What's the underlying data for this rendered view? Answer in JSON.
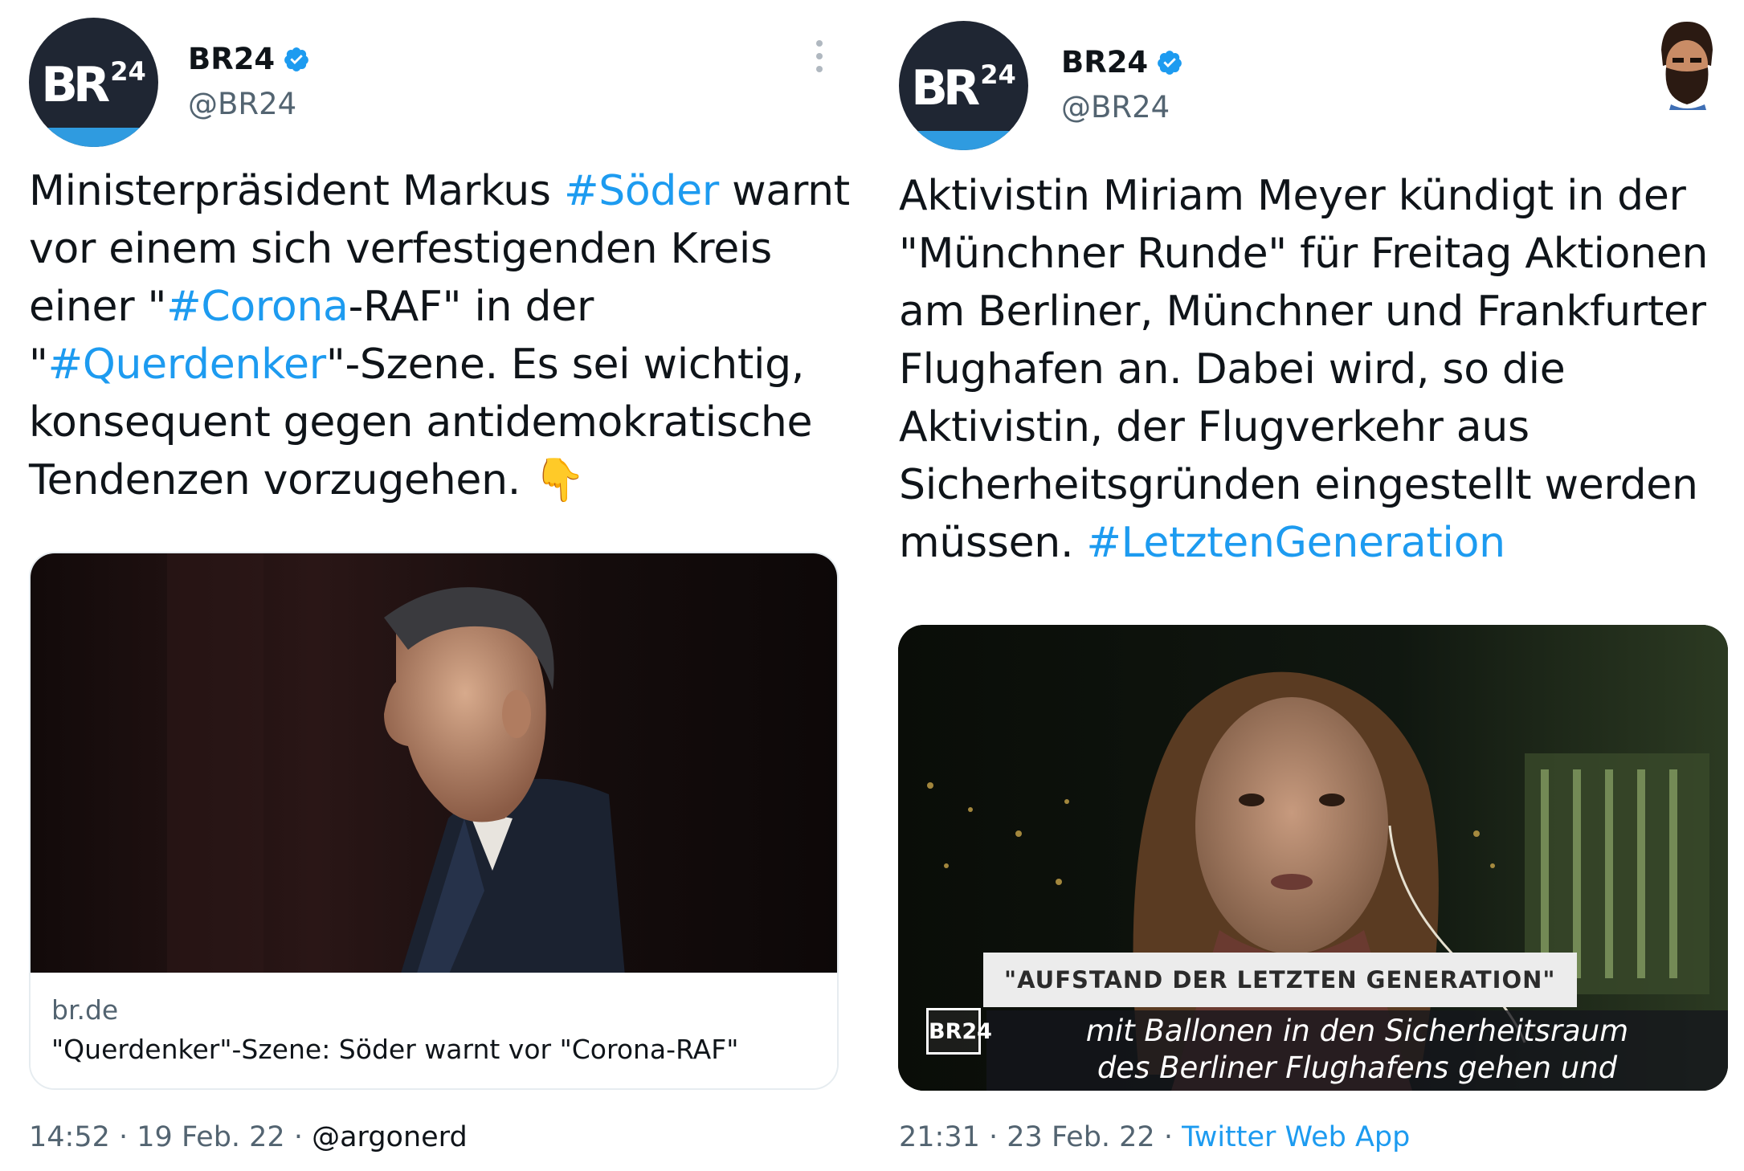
{
  "left": {
    "name": "BR24",
    "handle": "@BR24",
    "text_parts": [
      {
        "t": "Ministerpräsident Markus ",
        "tag": false
      },
      {
        "t": "#Söder",
        "tag": true
      },
      {
        "t": " warnt\nvor einem sich verfestigenden Kreis\neiner \"",
        "tag": false
      },
      {
        "t": "#Corona",
        "tag": true
      },
      {
        "t": "-RAF\" in der\n\"",
        "tag": false
      },
      {
        "t": "#Querdenker",
        "tag": true
      },
      {
        "t": "\"-Szene. Es sei wichtig,\nkonsequent gegen antidemokratische\nTendenzen vorzugehen. ",
        "tag": false
      },
      {
        "t": "👇",
        "tag": false
      }
    ],
    "card": {
      "domain": "br.de",
      "title": "\"Querdenker\"-Szene: Söder warnt vor \"Corona-RAF\""
    },
    "time": "14:52",
    "date": "19 Feb. 22",
    "source": "@argonerd"
  },
  "right": {
    "name": "BR24",
    "handle": "@BR24",
    "text_parts": [
      {
        "t": "Aktivistin Miriam Meyer kündigt in der\n\"Münchner Runde\" für Freitag Aktionen\nam Berliner, Münchner und Frankfurter\nFlughafen an. Dabei wird, so die\nAktivistin, der Flugverkehr aus\nSicherheitsgründen eingestellt werden\nmüssen. ",
        "tag": false
      },
      {
        "t": "#LetztenGeneration",
        "tag": true
      }
    ],
    "video": {
      "lower_third_title": "\"AUFSTAND DER LETZTEN GENERATION\"",
      "subtitle_line1": "mit Ballonen in den Sicherheitsraum",
      "subtitle_line2": "des Berliner Flughafens gehen und",
      "bug": "BR24"
    },
    "time": "21:31",
    "date": "23 Feb. 22",
    "source": "Twitter Web App"
  },
  "colors": {
    "link": "#1d9bf0",
    "secondary": "#536471",
    "avatar_bg": "#1f2633",
    "avatar_bar": "#2f9be0"
  }
}
